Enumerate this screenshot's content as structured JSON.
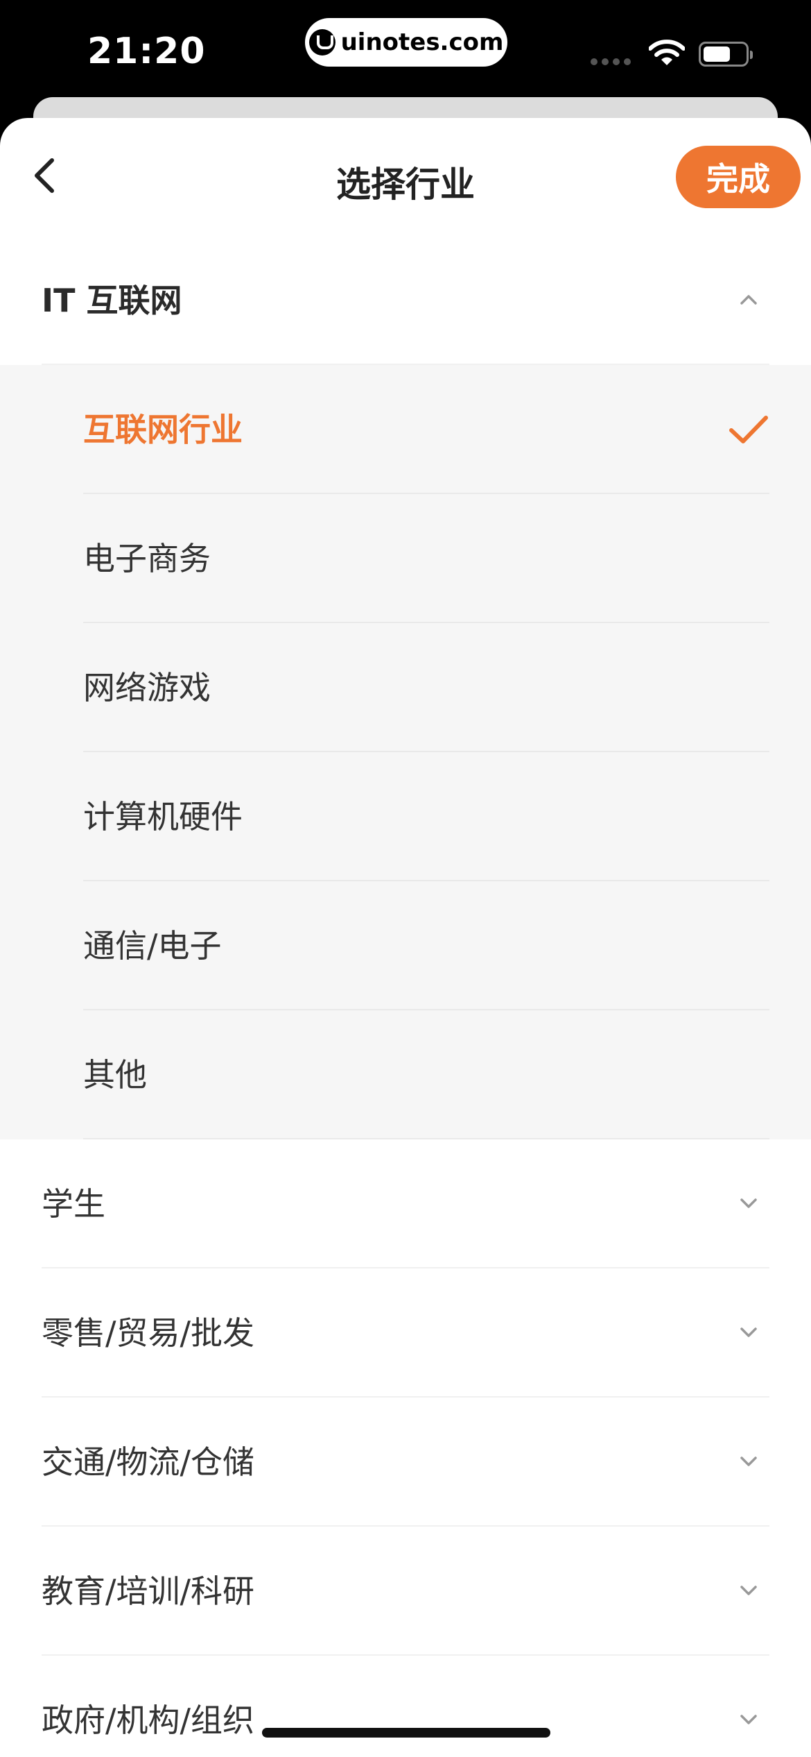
{
  "status_bar": {
    "time": "21:20",
    "watermark": "uinotes.com"
  },
  "nav": {
    "title": "选择行业",
    "done_label": "完成"
  },
  "colors": {
    "accent": "#ee7631",
    "sub_panel_bg": "#f6f6f6"
  },
  "categories": [
    {
      "label": "IT 互联网",
      "expanded": true,
      "children": [
        {
          "label": "互联网行业",
          "selected": true
        },
        {
          "label": "电子商务",
          "selected": false
        },
        {
          "label": "网络游戏",
          "selected": false
        },
        {
          "label": "计算机硬件",
          "selected": false
        },
        {
          "label": "通信/电子",
          "selected": false
        },
        {
          "label": "其他",
          "selected": false
        }
      ]
    },
    {
      "label": "学生",
      "expanded": false
    },
    {
      "label": "零售/贸易/批发",
      "expanded": false
    },
    {
      "label": "交通/物流/仓储",
      "expanded": false
    },
    {
      "label": "教育/培训/科研",
      "expanded": false
    },
    {
      "label": "政府/机构/组织",
      "expanded": false
    }
  ]
}
